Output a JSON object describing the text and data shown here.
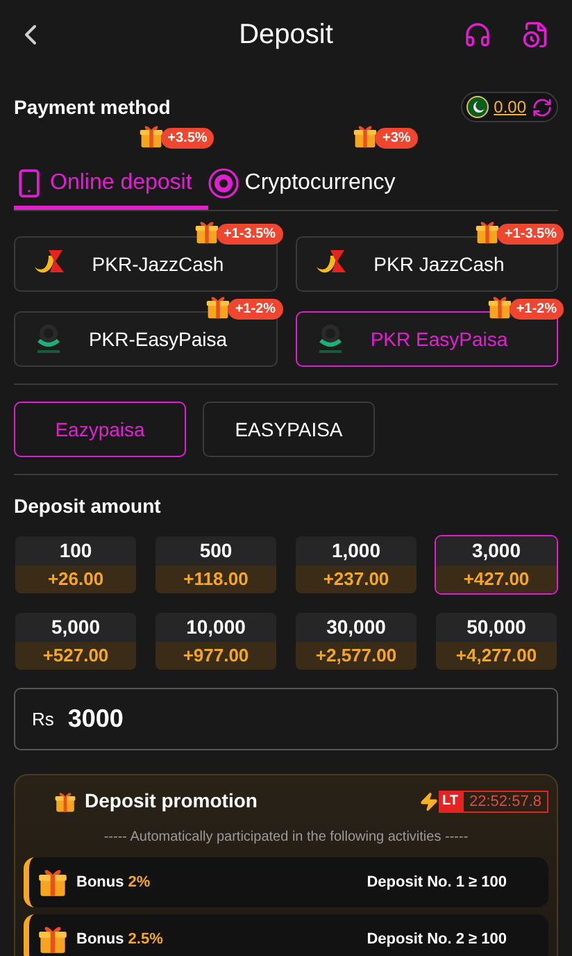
{
  "header": {
    "title": "Deposit"
  },
  "payment_method": {
    "title": "Payment method",
    "balance": "0.00"
  },
  "tabs": [
    {
      "label": "Online deposit",
      "badge": "+3.5%",
      "kind": "phone",
      "selected": true
    },
    {
      "label": "Cryptocurrency",
      "badge": "+3%",
      "kind": "coin",
      "selected": false
    }
  ],
  "channels": [
    {
      "name": "PKR-JazzCash",
      "badge": "+1-3.5%",
      "kind": "jazzcash",
      "selected": false
    },
    {
      "name": "PKR JazzCash",
      "badge": "+1-3.5%",
      "kind": "jazzcash",
      "selected": false
    },
    {
      "name": "PKR-EasyPaisa",
      "badge": "+1-2%",
      "kind": "easypaisa",
      "selected": false
    },
    {
      "name": "PKR EasyPaisa",
      "badge": "+1-2%",
      "kind": "easypaisa",
      "selected": true
    }
  ],
  "sub_channels": [
    {
      "label": "Eazypaisa",
      "selected": true
    },
    {
      "label": "EASYPAISA",
      "selected": false
    }
  ],
  "deposit_amount": {
    "title": "Deposit amount",
    "options": [
      {
        "amount": "100",
        "bonus": "+26.00",
        "selected": false
      },
      {
        "amount": "500",
        "bonus": "+118.00",
        "selected": false
      },
      {
        "amount": "1,000",
        "bonus": "+237.00",
        "selected": false
      },
      {
        "amount": "3,000",
        "bonus": "+427.00",
        "selected": true
      },
      {
        "amount": "5,000",
        "bonus": "+527.00",
        "selected": false
      },
      {
        "amount": "10,000",
        "bonus": "+977.00",
        "selected": false
      },
      {
        "amount": "30,000",
        "bonus": "+2,577.00",
        "selected": false
      },
      {
        "amount": "50,000",
        "bonus": "+4,277.00",
        "selected": false
      }
    ],
    "currency": "Rs",
    "value": "3000"
  },
  "promotion": {
    "title": "Deposit promotion",
    "tag": "LT",
    "timer": "22:52:57.8",
    "subtitle": "----- Automatically participated in the following activities -----",
    "items": [
      {
        "label": "Bonus",
        "rate": "2%",
        "condition": "Deposit No. 1 ≥ 100"
      },
      {
        "label": "Bonus",
        "rate": "2.5%",
        "condition": "Deposit No. 2 ≥ 100"
      }
    ]
  }
}
